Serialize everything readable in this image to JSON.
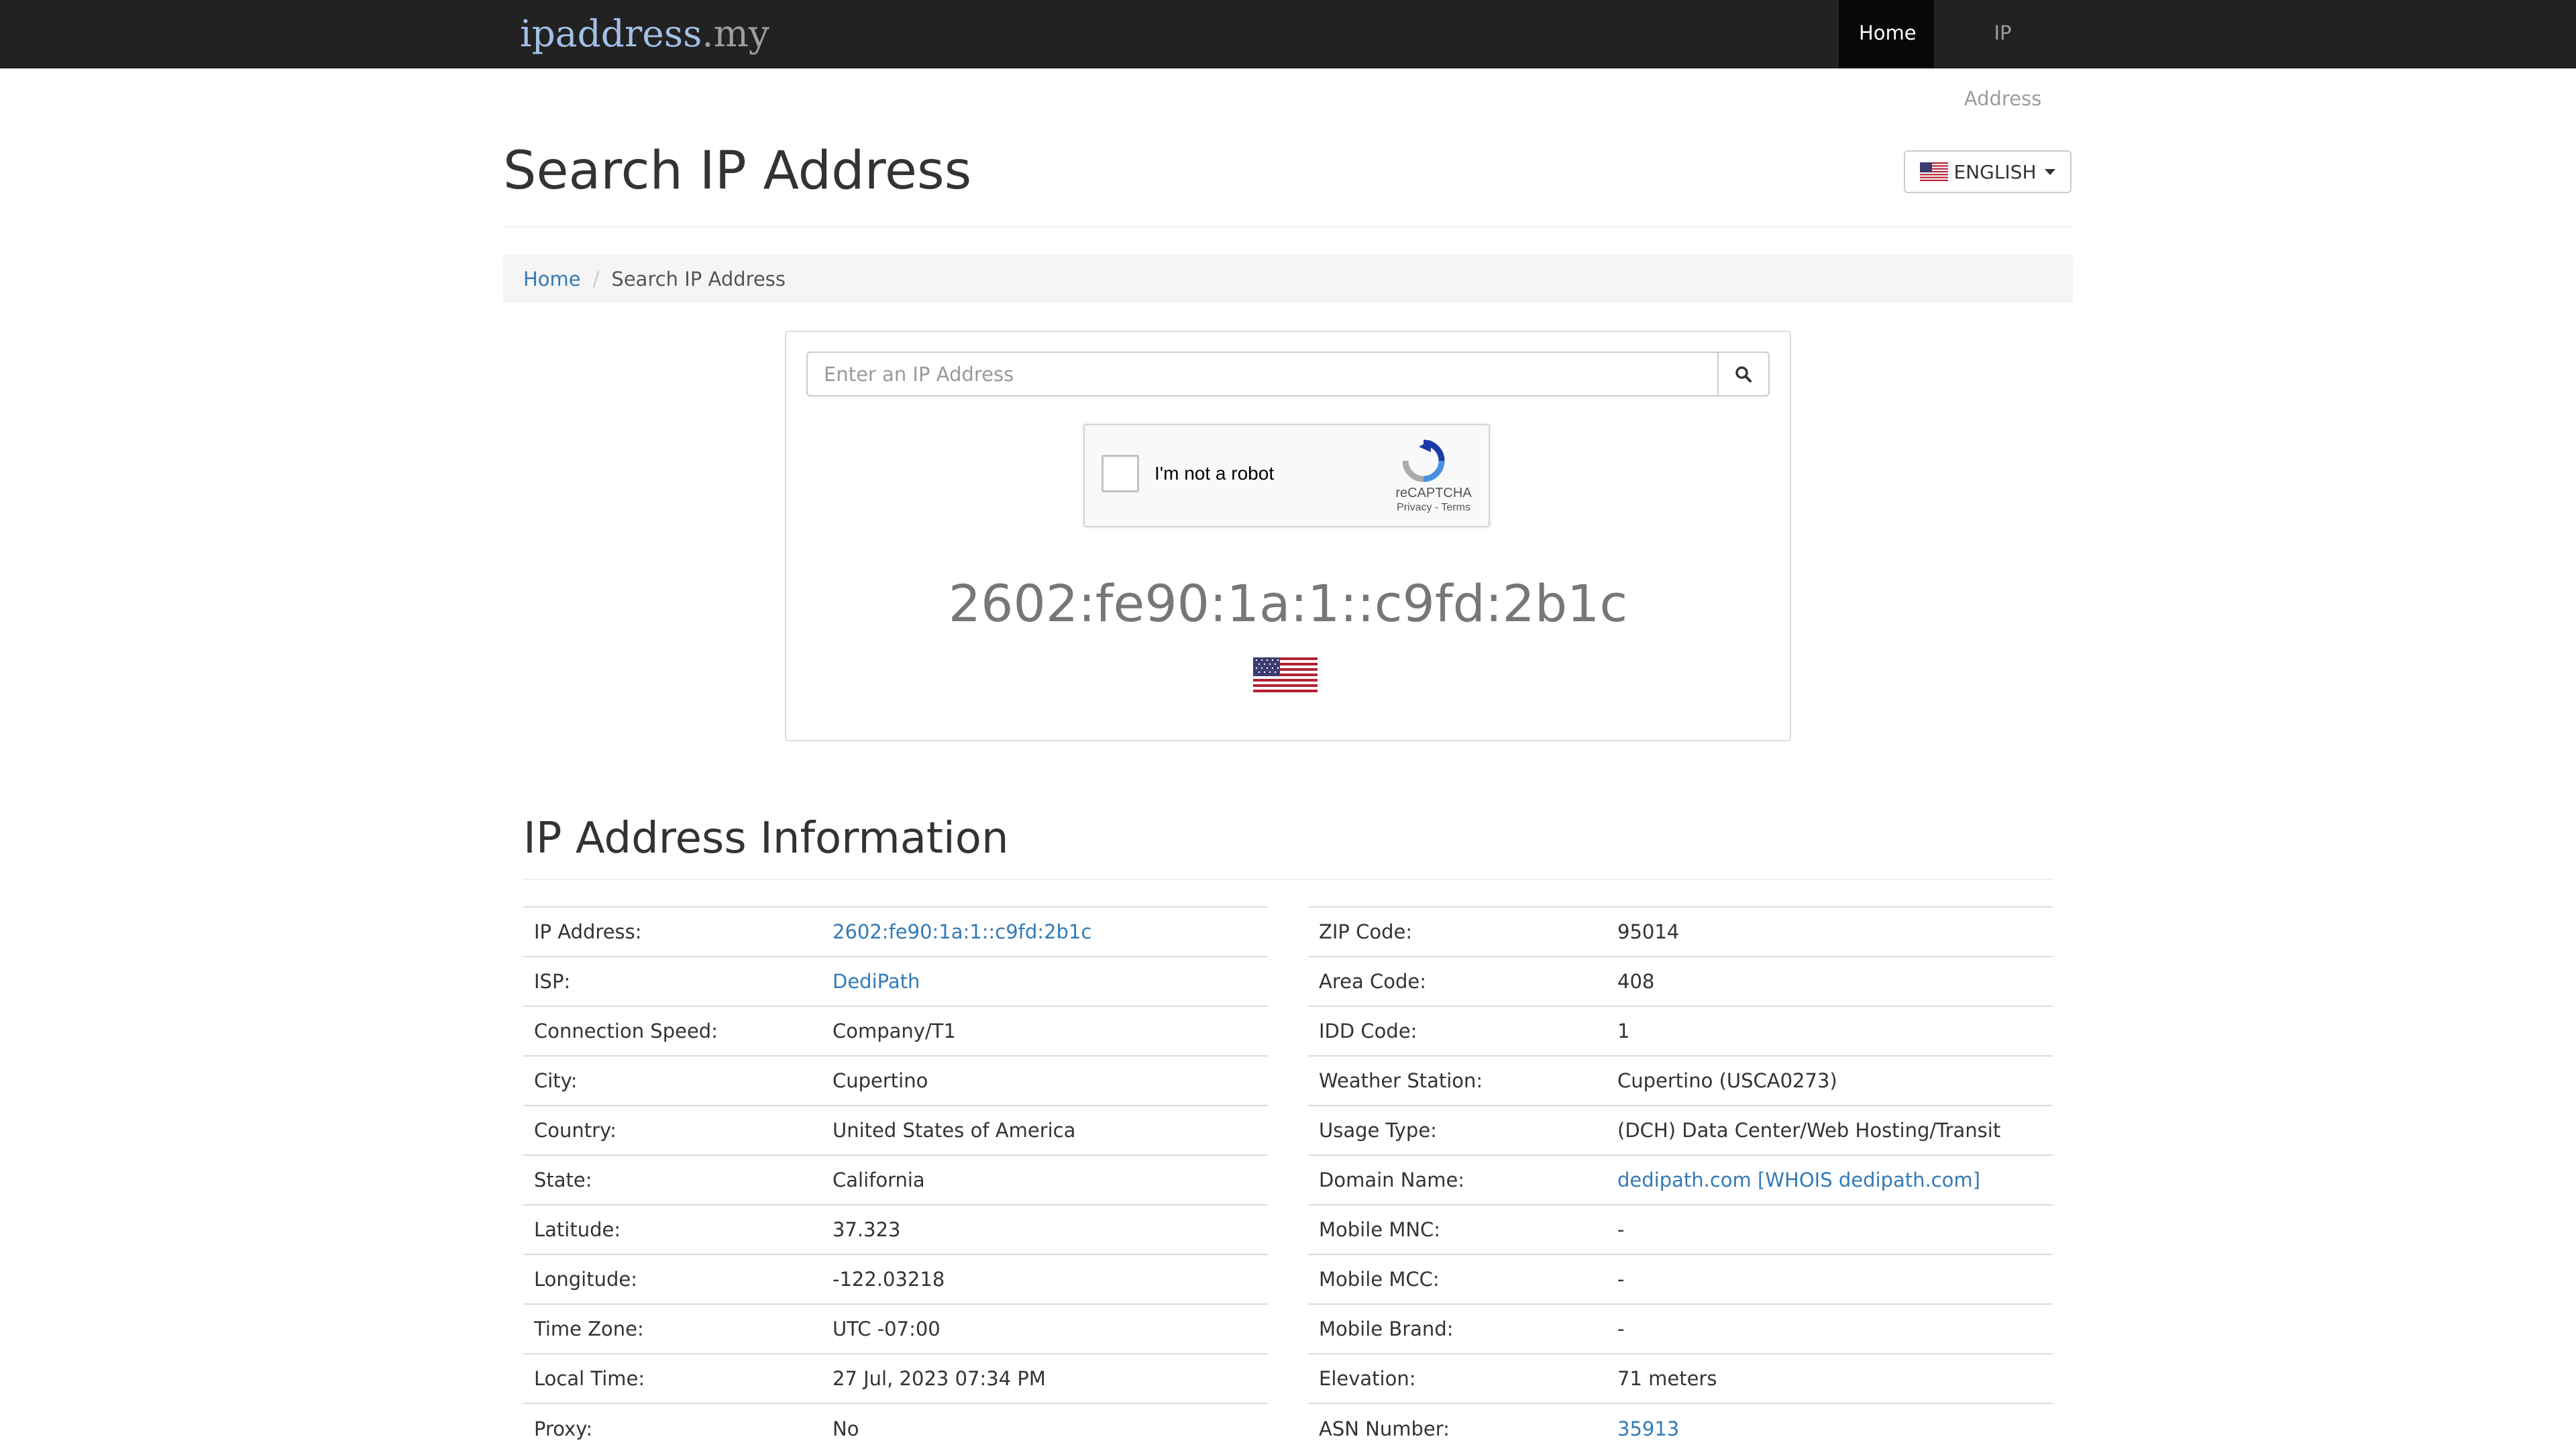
{
  "nav": {
    "brand_main": "ipaddress",
    "brand_tld": ".my",
    "items": [
      {
        "label": "Home",
        "active": true
      },
      {
        "label": "IP Address",
        "active": false
      }
    ]
  },
  "header": {
    "title": "Search IP Address",
    "language_label": "ENGLISH"
  },
  "breadcrumb": {
    "home": "Home",
    "current": "Search IP Address"
  },
  "search": {
    "placeholder": "Enter an IP Address",
    "button_icon": "search-icon"
  },
  "recaptcha": {
    "label": "I'm not a robot",
    "brand": "reCAPTCHA",
    "links": "Privacy - Terms"
  },
  "result": {
    "ip": "2602:fe90:1a:1::c9fd:2b1c",
    "flag_icon": "us-flag-icon"
  },
  "info": {
    "title": "IP Address Information",
    "left_rows": [
      {
        "label": "IP Address:",
        "value": "2602:fe90:1a:1::c9fd:2b1c",
        "link": true
      },
      {
        "label": "ISP:",
        "value": "DediPath",
        "link": true
      },
      {
        "label": "Connection Speed:",
        "value": "Company/T1",
        "link": false
      },
      {
        "label": "City:",
        "value": "Cupertino",
        "link": false
      },
      {
        "label": "Country:",
        "value": "United States of America",
        "link": false
      },
      {
        "label": "State:",
        "value": "California",
        "link": false
      },
      {
        "label": "Latitude:",
        "value": "37.323",
        "link": false
      },
      {
        "label": "Longitude:",
        "value": "-122.03218",
        "link": false
      },
      {
        "label": "Time Zone:",
        "value": "UTC -07:00",
        "link": false
      },
      {
        "label": "Local Time:",
        "value": "27 Jul, 2023 07:34 PM",
        "link": false
      },
      {
        "label": "Proxy:",
        "value": "No",
        "link": false
      }
    ],
    "right_rows": [
      {
        "label": "ZIP Code:",
        "value": "95014",
        "link": false
      },
      {
        "label": "Area Code:",
        "value": "408",
        "link": false
      },
      {
        "label": "IDD Code:",
        "value": "1",
        "link": false
      },
      {
        "label": "Weather Station:",
        "value": "Cupertino (USCA0273)",
        "link": false
      },
      {
        "label": "Usage Type:",
        "value": "(DCH) Data Center/Web Hosting/Transit",
        "link": false
      },
      {
        "label": "Domain Name:",
        "value": "dedipath.com [WHOIS dedipath.com]",
        "link": true
      },
      {
        "label": "Mobile MNC:",
        "value": "-",
        "link": false
      },
      {
        "label": "Mobile MCC:",
        "value": "-",
        "link": false
      },
      {
        "label": "Mobile Brand:",
        "value": "-",
        "link": false
      },
      {
        "label": "Elevation:",
        "value": "71 meters",
        "link": false
      },
      {
        "label": "ASN Number:",
        "value": "35913",
        "link": true
      }
    ]
  },
  "colors": {
    "navbar": "#222222",
    "link": "#337ab7",
    "text": "#333333"
  }
}
